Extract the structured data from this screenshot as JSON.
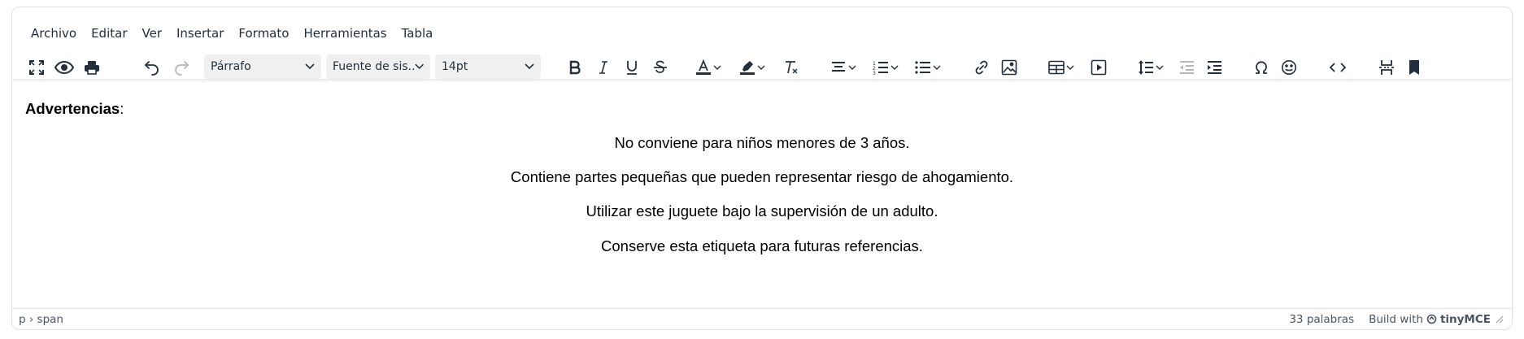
{
  "menubar": {
    "items": [
      "Archivo",
      "Editar",
      "Ver",
      "Insertar",
      "Formato",
      "Herramientas",
      "Tabla"
    ]
  },
  "toolbar": {
    "block_format": "Párrafo",
    "font_family": "Fuente de sis...",
    "font_size": "14pt",
    "buttons": [
      "fullscreen-icon",
      "preview-icon",
      "print-icon",
      "undo-icon",
      "redo-icon",
      "bold-icon",
      "italic-icon",
      "underline-icon",
      "strikethrough-icon",
      "text-color-icon",
      "highlight-icon",
      "remove-format-icon",
      "align-icon",
      "numbered-list-icon",
      "bullet-list-icon",
      "link-icon",
      "image-icon",
      "table-icon",
      "media-icon",
      "line-height-icon",
      "outdent-icon",
      "indent-icon",
      "special-char-icon",
      "emoji-icon",
      "source-code-icon",
      "page-break-icon",
      "anchor-icon"
    ]
  },
  "content": {
    "heading": "Advertencias",
    "heading_suffix": ":",
    "lines": [
      "No conviene para niños menores de 3 años.",
      "Contiene partes pequeñas que pueden representar riesgo de ahogamiento.",
      "Utilizar este juguete bajo la supervisión de un adulto.",
      "Conserve esta etiqueta para futuras referencias."
    ]
  },
  "statusbar": {
    "path": "p › span",
    "word_count": "33 palabras",
    "build_with": "Build with",
    "brand": "tinyMCE"
  },
  "colors": {
    "text": "#222f3e",
    "disabled": "#b4b8be",
    "border": "#dee0e3",
    "select_bg": "#f0f0f0"
  }
}
